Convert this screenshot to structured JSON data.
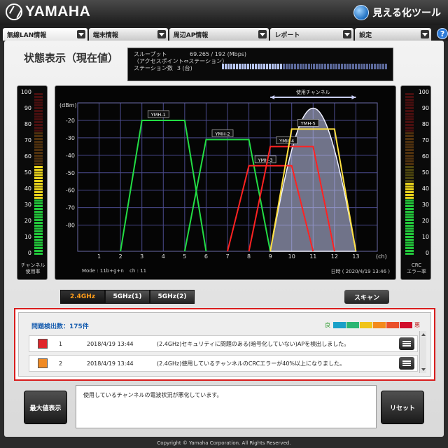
{
  "header": {
    "brand": "YAMAHA",
    "tool_name": "見える化ツール",
    "help_label": "?"
  },
  "tabs": [
    {
      "label": "無線LAN情報"
    },
    {
      "label": "端末情報"
    },
    {
      "label": "周辺AP情報"
    },
    {
      "label": "レポート"
    },
    {
      "label": "設定"
    }
  ],
  "page": {
    "title": "状態表示（現在値）"
  },
  "status": {
    "throughput_label": "スループット",
    "throughput_value": "69.265 / 192 (Mbps)",
    "throughput_sub": "（アクセスポイント⇔ステーション）",
    "stations_label": "ステーション数",
    "stations_value": "3 (台)",
    "throughput_fraction": 0.36
  },
  "left_meter": {
    "ticks": [
      "100",
      "90",
      "80",
      "70",
      "60",
      "50",
      "40",
      "30",
      "20",
      "10",
      "0"
    ],
    "caption_line1": "チャンネル",
    "caption_line2": "使用率",
    "level": 0.55
  },
  "right_meter": {
    "ticks": [
      "100",
      "90",
      "80",
      "70",
      "60",
      "50",
      "40",
      "30",
      "20",
      "10",
      "0"
    ],
    "caption_line1": "CRC",
    "caption_line2": "エラー率",
    "level": 0.45
  },
  "chart_data": {
    "type": "area",
    "ylabel": "(dBm)",
    "xlabel": "(ch)",
    "y_ticks": [
      -20,
      -30,
      -40,
      -50,
      -60,
      -70,
      -80
    ],
    "x_ticks": [
      1,
      2,
      3,
      4,
      5,
      6,
      7,
      8,
      9,
      10,
      11,
      12,
      13
    ],
    "xlim": [
      0,
      14
    ],
    "ylim": [
      -95,
      -10
    ],
    "used_channel_label": "使用チャンネル",
    "used_channel_range": [
      9,
      13
    ],
    "own_ap": {
      "center": 11,
      "peak": -13,
      "color": "#c8cdf5"
    },
    "series": [
      {
        "name": "YMH-1",
        "start": 2,
        "end": 6,
        "level": -20,
        "color": "#22dd44"
      },
      {
        "name": "YMH-2",
        "start": 5,
        "end": 9,
        "level": -31,
        "color": "#22dd44"
      },
      {
        "name": "YMH-3",
        "start": 7,
        "end": 11,
        "level": -46,
        "color": "#ff2222"
      },
      {
        "name": "YMH-4",
        "start": 8,
        "end": 12,
        "level": -35,
        "color": "#ff2222"
      },
      {
        "name": "YMH-5",
        "start": 9,
        "end": 13,
        "level": -25,
        "color": "#ffe040"
      }
    ],
    "mode_text": "Mode : 11b+g+n",
    "ch_text": "ch : 11",
    "datetime_text": "日時 ( 2020/4/19 13:46 )"
  },
  "bands": {
    "b24": "2.4GHz",
    "b5_1": "5GHz(1)",
    "b5_2": "5GHz(2)",
    "scan": "スキャン"
  },
  "problems": {
    "heading": "問題検出数：175件",
    "good_label": "良",
    "bad_label": "悪",
    "severity_colors": [
      "#1aa0c8",
      "#2bb673",
      "#f0c419",
      "#f38a1c",
      "#ea4f2a",
      "#d10d2b"
    ],
    "rows": [
      {
        "num": "1",
        "datetime": "2018/4/19 13:44",
        "message": "(2.4GHz)セキュリティに問題のある(暗号化していない)APを検出しました。",
        "color": "#e0262b"
      },
      {
        "num": "2",
        "datetime": "2018/4/19 13:44",
        "message": "(2.4GHz)使用しているチャンネルのCRCエラーが40%以上になりました。",
        "color": "#f08a24"
      }
    ]
  },
  "bottom": {
    "maximize_label": "最大値表示",
    "message": "使用しているチャンネルの電波状況が悪化しています。",
    "reset_label": "リセット",
    "copyright": "Copyright © Yamaha Corporation. All Rights Reserved."
  }
}
